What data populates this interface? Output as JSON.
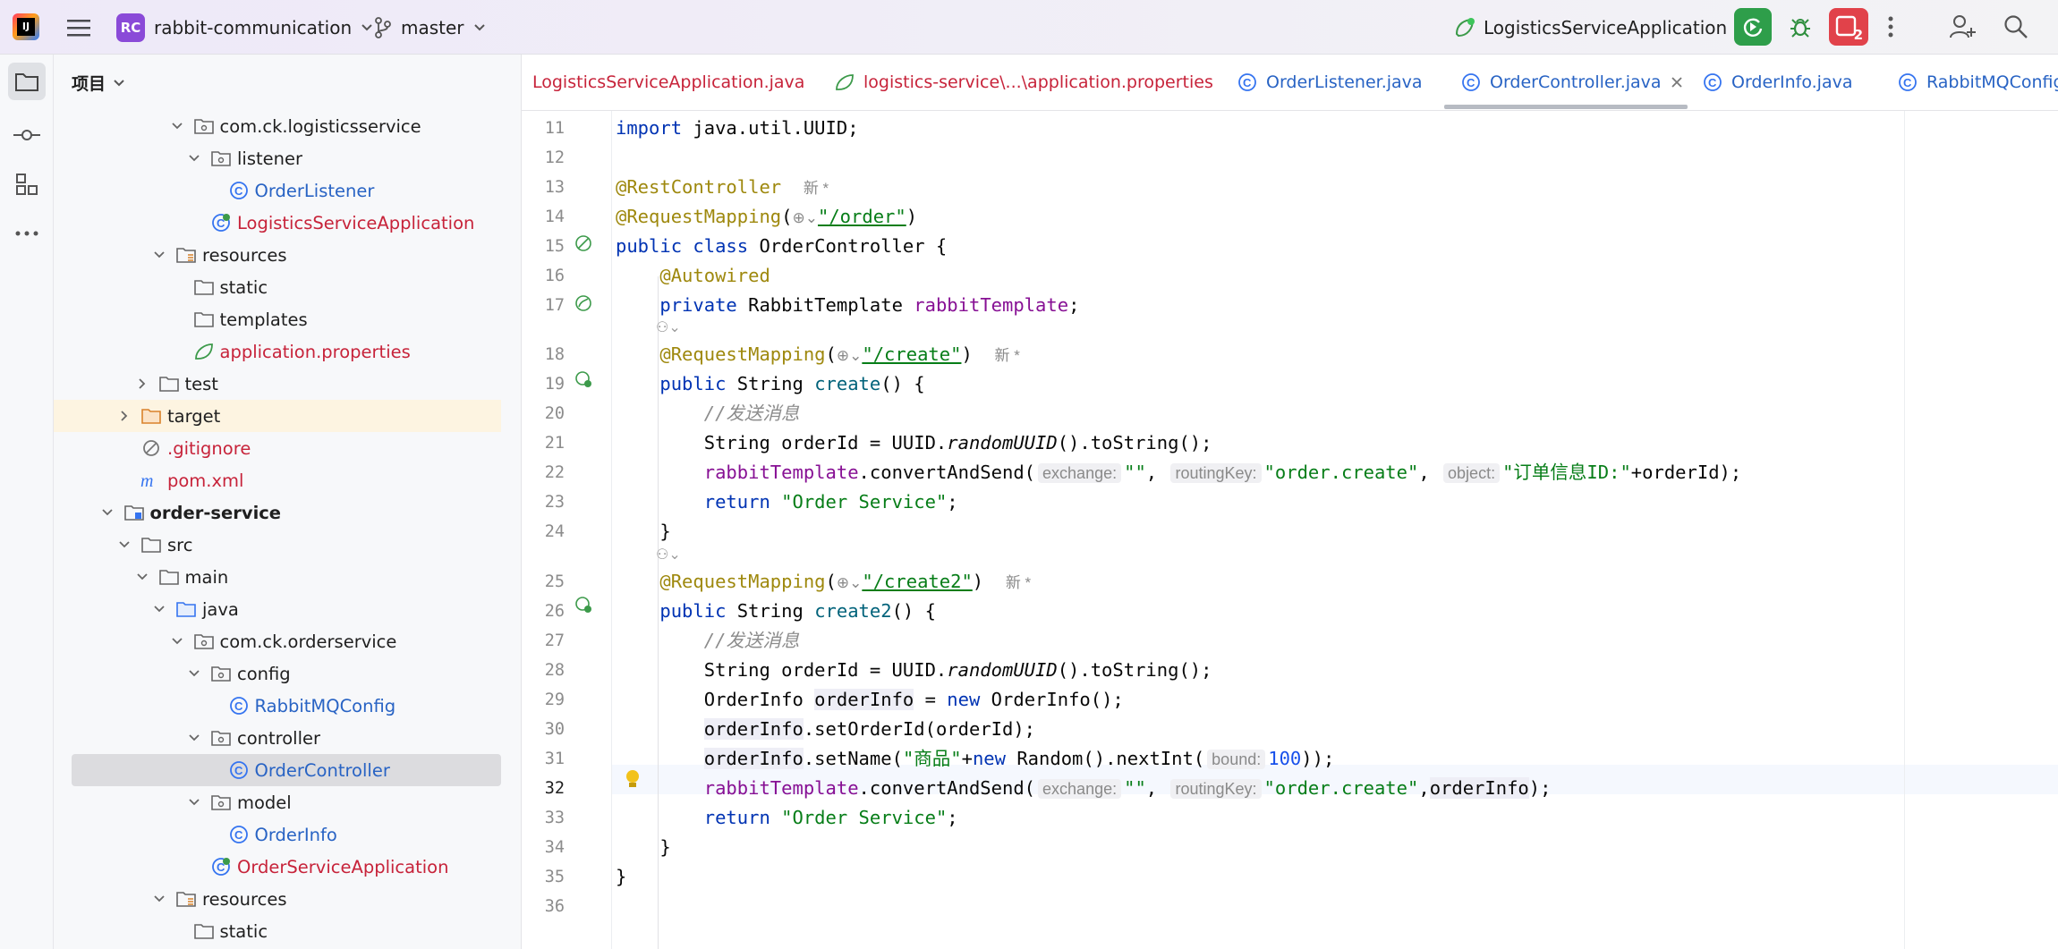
{
  "header": {
    "project_badge": "RC",
    "project_name": "rabbit-communication",
    "branch": "master",
    "run_config": "LogisticsServiceApplication",
    "stop_count": "2"
  },
  "project_panel": {
    "title": "项目",
    "rows": [
      {
        "label": "com.ck.logisticsservice"
      },
      {
        "label": "listener"
      },
      {
        "label": "OrderListener"
      },
      {
        "label": "LogisticsServiceApplication"
      },
      {
        "label": "resources"
      },
      {
        "label": "static"
      },
      {
        "label": "templates"
      },
      {
        "label": "application.properties"
      },
      {
        "label": "test"
      },
      {
        "label": "target"
      },
      {
        "label": ".gitignore"
      },
      {
        "label": "pom.xml"
      },
      {
        "label": "order-service"
      },
      {
        "label": "src"
      },
      {
        "label": "main"
      },
      {
        "label": "java"
      },
      {
        "label": "com.ck.orderservice"
      },
      {
        "label": "config"
      },
      {
        "label": "RabbitMQConfig"
      },
      {
        "label": "controller"
      },
      {
        "label": "OrderController"
      },
      {
        "label": "model"
      },
      {
        "label": "OrderInfo"
      },
      {
        "label": "OrderServiceApplication"
      },
      {
        "label": "resources"
      },
      {
        "label": "static"
      }
    ]
  },
  "tabs": [
    {
      "label": "LogisticsServiceApplication.java"
    },
    {
      "label": "logistics-service\\...\\application.properties"
    },
    {
      "label": "OrderListener.java"
    },
    {
      "label": "OrderController.java"
    },
    {
      "label": "OrderInfo.java"
    },
    {
      "label": "RabbitMQConfig"
    }
  ],
  "editor": {
    "line_numbers": [
      "11",
      "12",
      "13",
      "14",
      "15",
      "16",
      "17",
      "18",
      "19",
      "20",
      "21",
      "22",
      "23",
      "24",
      "25",
      "26",
      "27",
      "28",
      "29",
      "30",
      "31",
      "32",
      "33",
      "34",
      "35",
      "36"
    ],
    "new_marker": "新 *",
    "path_order": "\"/order\"",
    "path_create": "\"/create\"",
    "path_create2": "\"/create2\"",
    "comment_send": "//发送消息",
    "hint_exchange": "exchange:",
    "hint_routing": "routingKey:",
    "hint_object": "object:",
    "hint_bound": "bound:",
    "str_empty": "\"\"",
    "str_order_create": "\"order.create\"",
    "str_order_id": "\"订单信息ID:\"",
    "str_order_service": "\"Order Service\"",
    "str_goods": "\"商品\"",
    "num_100": "100"
  }
}
